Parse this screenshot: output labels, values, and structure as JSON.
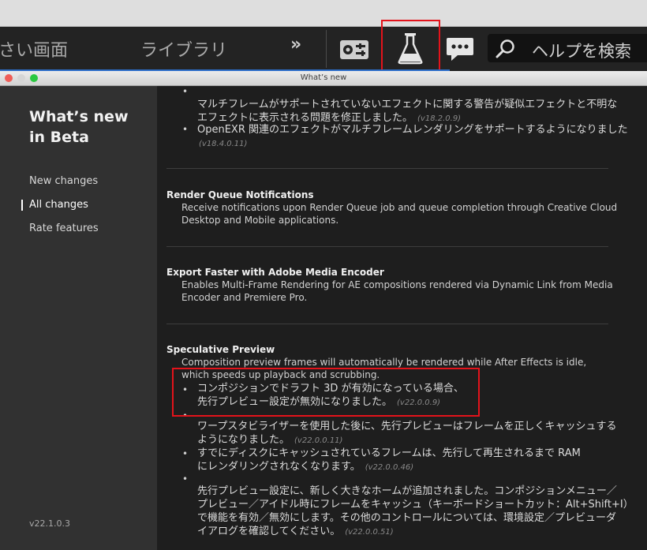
{
  "appbar": {
    "tab_small_screen": "さい画面",
    "tab_library": "ライブラリ",
    "more": "»",
    "search_placeholder": "ヘルプを検索",
    "icons": [
      "workspace-settings-icon",
      "beta-flask-icon",
      "chat-feedback-icon",
      "search-icon"
    ]
  },
  "dialog": {
    "title": "What’s new"
  },
  "sidebar": {
    "title_line1": "What’s new",
    "title_line2": "in Beta",
    "items": [
      {
        "label": "New changes"
      },
      {
        "label": "All changes"
      },
      {
        "label": "Rate features"
      }
    ],
    "version": "v22.1.0.3"
  },
  "content": {
    "top_bullets": [
      {
        "line1": "マルチフレームがサポートされていないエフェクトに関する警告が疑似エフェクトと不明な",
        "line2": "エフェクトに表示される問題を修正しました。",
        "version": "(v18.2.0.9)"
      },
      {
        "line1": "OpenEXR 関連のエフェクトがマルチフレームレンダリングをサポートするようになりました",
        "version": "(v18.4.0.11)"
      }
    ],
    "render_queue": {
      "title": "Render Queue Notifications",
      "body": "Receive notifications upon Render Queue job and queue completion through Creative Cloud Desktop and Mobile applications."
    },
    "export_faster": {
      "title": "Export Faster with Adobe Media Encoder",
      "body": "Enables Multi-Frame Rendering for AE compositions rendered via Dynamic Link from Media Encoder and Premiere Pro."
    },
    "speculative": {
      "title": "Speculative Preview",
      "body": "Composition preview frames will automatically be rendered while After Effects is idle, which speeds up playback and scrubbing.",
      "bullets": [
        {
          "line1": "コンポジションでドラフト 3D が有効になっている場合、",
          "line2": "先行プレビュー設定が無効になりました。",
          "version": "(v22.0.0.9)"
        },
        {
          "line1": "ワープスタビライザーを使用した後に、先行プレビューはフレームを正しくキャッシュする",
          "line2": "ようになりました。",
          "version": "(v22.0.0.11)"
        },
        {
          "line1": "すでにディスクにキャッシュされているフレームは、先行して再生されるまで RAM",
          "line2": "にレンダリングされなくなります。",
          "version": "(v22.0.0.46)"
        },
        {
          "line1": "先行プレビュー設定に、新しく大きなホームが追加されました。コンポジションメニュー／",
          "line2": "プレビュー／アイドル時にフレームをキャッシュ（キーボードショートカット：Alt+Shift+I）",
          "line3": "で機能を有効／無効にします。その他のコントロールについては、環境設定／プレビューダ",
          "line4": "イアログを確認してください。",
          "version": "(v22.0.0.51)"
        }
      ]
    }
  },
  "colors": {
    "highlight_red": "#e3131b",
    "sidebar_bg": "#313131",
    "content_bg": "#1e1e1e",
    "accent_blue": "#2d6ec9"
  }
}
